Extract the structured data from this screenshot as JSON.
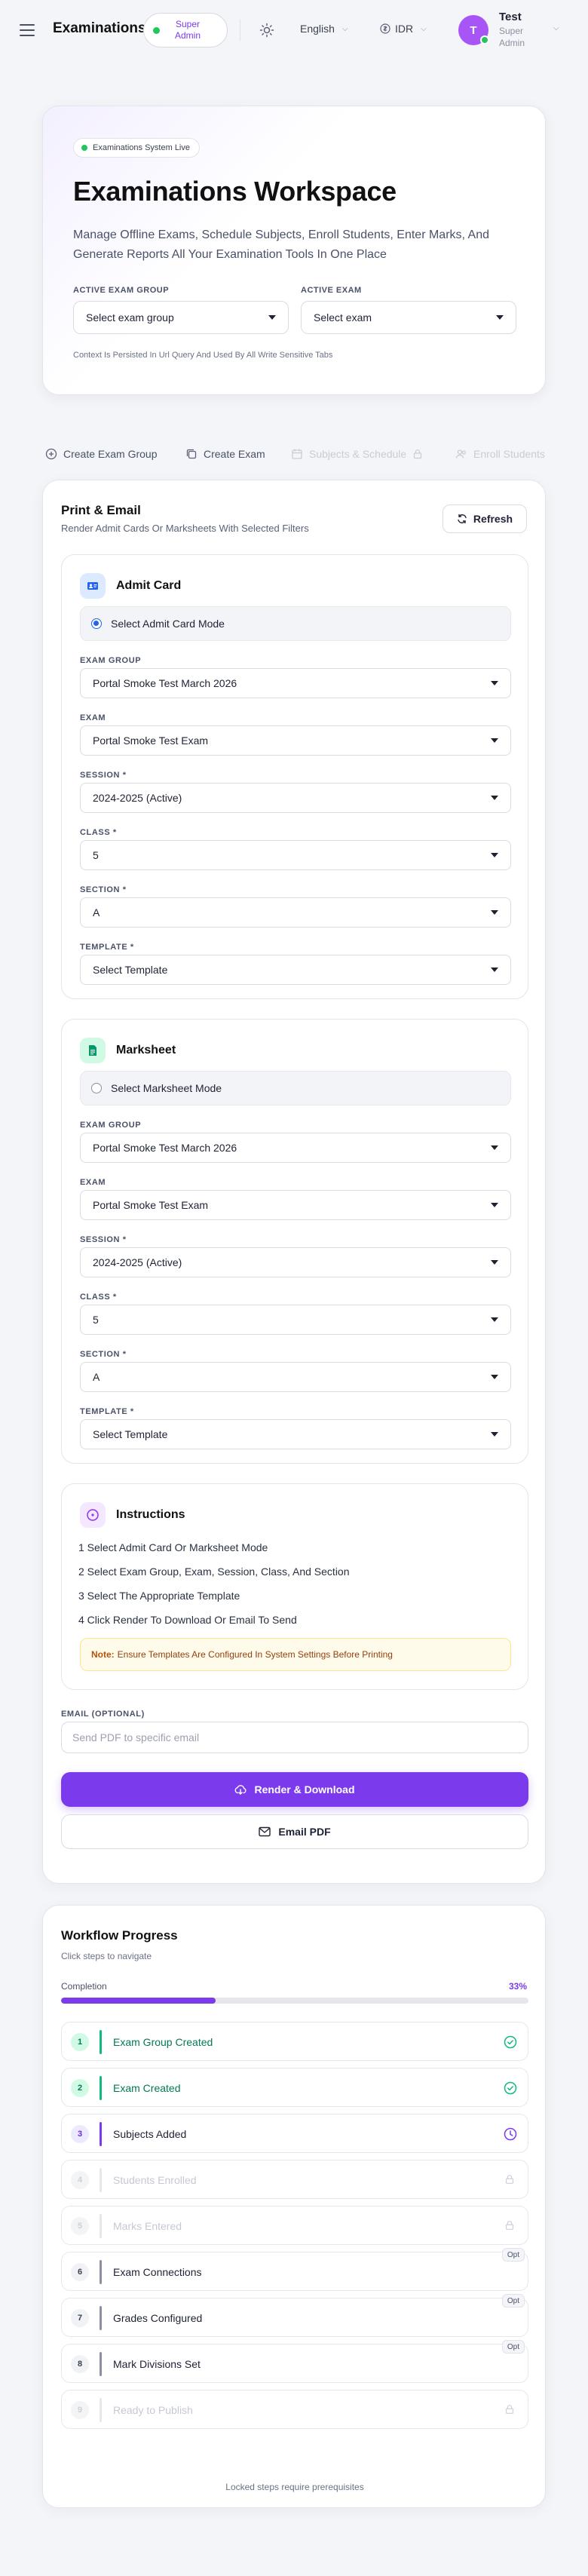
{
  "header": {
    "app_title": "Examinations",
    "role_badge": "Super Admin",
    "language": "English",
    "currency": "IDR",
    "user_initial": "T",
    "user_name": "Test",
    "user_role": "Super Admin"
  },
  "hero": {
    "status_pill": "Examinations System Live",
    "title": "Examinations Workspace",
    "description": "Manage Offline Exams, Schedule Subjects, Enroll Students, Enter Marks, And Generate Reports All Your Examination Tools In One Place",
    "active_exam_group_label": "ACTIVE EXAM GROUP",
    "active_exam_group_value": "Select exam group",
    "active_exam_label": "ACTIVE EXAM",
    "active_exam_value": "Select exam",
    "context_note": "Context Is Persisted In Url Query And Used By All Write Sensitive Tabs"
  },
  "tabs": [
    {
      "label": "Create Exam Group",
      "icon": "plus-circle-icon",
      "enabled": true
    },
    {
      "label": "Create Exam",
      "icon": "copy-icon",
      "enabled": true
    },
    {
      "label": "Subjects & Schedule",
      "icon": "calendar-icon",
      "enabled": false
    },
    {
      "label": "Enroll Students",
      "icon": "users-icon",
      "enabled": false
    }
  ],
  "print": {
    "title": "Print & Email",
    "subtitle": "Render Admit Cards Or Marksheets With Selected Filters",
    "refresh_label": "Refresh",
    "admit_card": {
      "title": "Admit Card",
      "mode_label": "Select Admit Card Mode",
      "mode_selected": true,
      "fields": [
        {
          "label": "EXAM GROUP",
          "value": "Portal Smoke Test March 2026"
        },
        {
          "label": "EXAM",
          "value": "Portal Smoke Test Exam"
        },
        {
          "label": "SESSION *",
          "value": "2024-2025 (Active)"
        },
        {
          "label": "CLASS *",
          "value": "5"
        },
        {
          "label": "SECTION *",
          "value": "A"
        },
        {
          "label": "TEMPLATE *",
          "value": "Select Template"
        }
      ]
    },
    "marksheet": {
      "title": "Marksheet",
      "mode_label": "Select Marksheet Mode",
      "mode_selected": false,
      "fields": [
        {
          "label": "EXAM GROUP",
          "value": "Portal Smoke Test March 2026"
        },
        {
          "label": "EXAM",
          "value": "Portal Smoke Test Exam"
        },
        {
          "label": "SESSION *",
          "value": "2024-2025 (Active)"
        },
        {
          "label": "CLASS *",
          "value": "5"
        },
        {
          "label": "SECTION *",
          "value": "A"
        },
        {
          "label": "TEMPLATE *",
          "value": "Select Template"
        }
      ]
    },
    "instructions": {
      "title": "Instructions",
      "steps": [
        "1 Select Admit Card Or Marksheet Mode",
        "2 Select Exam Group, Exam, Session, Class, And Section",
        "3 Select The Appropriate Template",
        "4 Click Render To Download Or Email To Send"
      ],
      "note_label": "Note:",
      "note_text": "Ensure Templates Are Configured In System Settings Before Printing"
    },
    "email_label": "EMAIL (OPTIONAL)",
    "email_placeholder": "Send PDF to specific email",
    "render_label": "Render & Download",
    "email_pdf_label": "Email PDF"
  },
  "workflow": {
    "title": "Workflow Progress",
    "subtitle": "Click steps to navigate",
    "completion_label": "Completion",
    "completion_text": "33%",
    "completion_fraction": 0.33,
    "optional_tag": "Opt",
    "steps": [
      {
        "num": "1",
        "label": "Exam Group Created",
        "state": "done"
      },
      {
        "num": "2",
        "label": "Exam Created",
        "state": "done"
      },
      {
        "num": "3",
        "label": "Subjects Added",
        "state": "active"
      },
      {
        "num": "4",
        "label": "Students Enrolled",
        "state": "locked"
      },
      {
        "num": "5",
        "label": "Marks Entered",
        "state": "locked"
      },
      {
        "num": "6",
        "label": "Exam Connections",
        "state": "optional"
      },
      {
        "num": "7",
        "label": "Grades Configured",
        "state": "optional"
      },
      {
        "num": "8",
        "label": "Mark Divisions Set",
        "state": "optional"
      },
      {
        "num": "9",
        "label": "Ready to Publish",
        "state": "locked"
      }
    ],
    "footer": "Locked steps require prerequisites"
  },
  "colors": {
    "accent": "#7c3aed",
    "success": "#10b981",
    "live": "#22c55e"
  }
}
